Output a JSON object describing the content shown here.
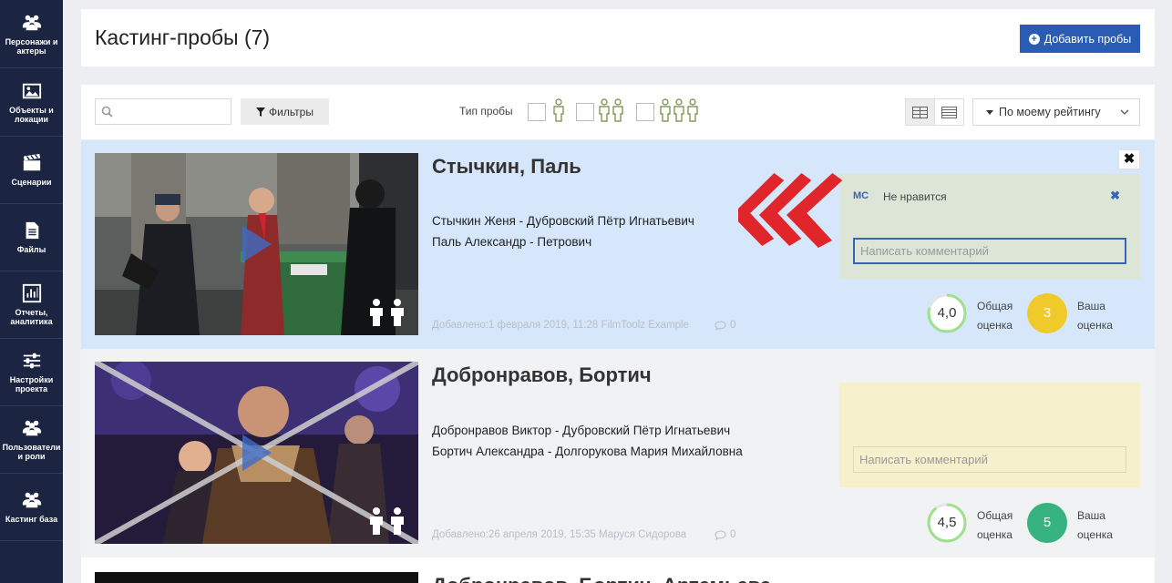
{
  "sidebar": {
    "items": [
      {
        "label": "Персонажи и актеры",
        "icon": "users-icon"
      },
      {
        "label": "Объекты и локации",
        "icon": "image-icon"
      },
      {
        "label": "Сценарии",
        "icon": "clapperboard-icon"
      },
      {
        "label": "Файлы",
        "icon": "file-icon"
      },
      {
        "label": "Отчеты, аналитика",
        "icon": "chart-icon"
      },
      {
        "label": "Настройки проекта",
        "icon": "sliders-icon"
      },
      {
        "label": "Пользователи и роли",
        "icon": "users-icon"
      },
      {
        "label": "Кастинг база",
        "icon": "users-icon"
      }
    ]
  },
  "header": {
    "title": "Кастинг-пробы (7)",
    "add_button": "Добавить пробы"
  },
  "toolbar": {
    "search_placeholder": "",
    "filter_button": "Фильтры",
    "probe_type_label": "Тип пробы",
    "sort_value": "По моему рейтингу"
  },
  "cards": [
    {
      "name": "Стычкин, Паль",
      "roles": [
        "Стычкин Женя - Дубровский Пётр Игнатьевич",
        "Паль Александр - Петрович"
      ],
      "added": "Добавлено:1 февраля 2019, 11:28  FilmToolz Example",
      "comments_count": "0",
      "comment": {
        "author": "MC",
        "text": "Не нравится",
        "delete": "✖"
      },
      "comment_placeholder": "Написать комментарий",
      "overall_rating": "4,0",
      "overall_label_1": "Общая",
      "overall_label_2": "оценка",
      "my_rating": "3",
      "my_label_1": "Ваша",
      "my_label_2": "оценка",
      "close": "✖",
      "my_rating_color": "#f0c92b"
    },
    {
      "name": "Добронравов, Бортич",
      "roles": [
        "Добронравов Виктор - Дубровский Пётр Игнатьевич",
        "Бортич Александра - Долгорукова Мария Михайловна"
      ],
      "added": "Добавлено:26 апреля 2019, 15:35  Маруся Сидорова",
      "comments_count": "0",
      "comment_placeholder": "Написать комментарий",
      "overall_rating": "4,5",
      "overall_label_1": "Общая",
      "overall_label_2": "оценка",
      "my_rating": "5",
      "my_label_1": "Ваша",
      "my_label_2": "оценка",
      "my_rating_color": "#36b37e"
    },
    {
      "name": "Добронравов, Бортич, Артемьева"
    }
  ],
  "colors": {
    "sidebar": "#1b2440",
    "accent": "#2a5bb5",
    "selected_card": "#d7e7fb",
    "rating_ring": "#9ee08f",
    "arrow": "#e0262b"
  }
}
